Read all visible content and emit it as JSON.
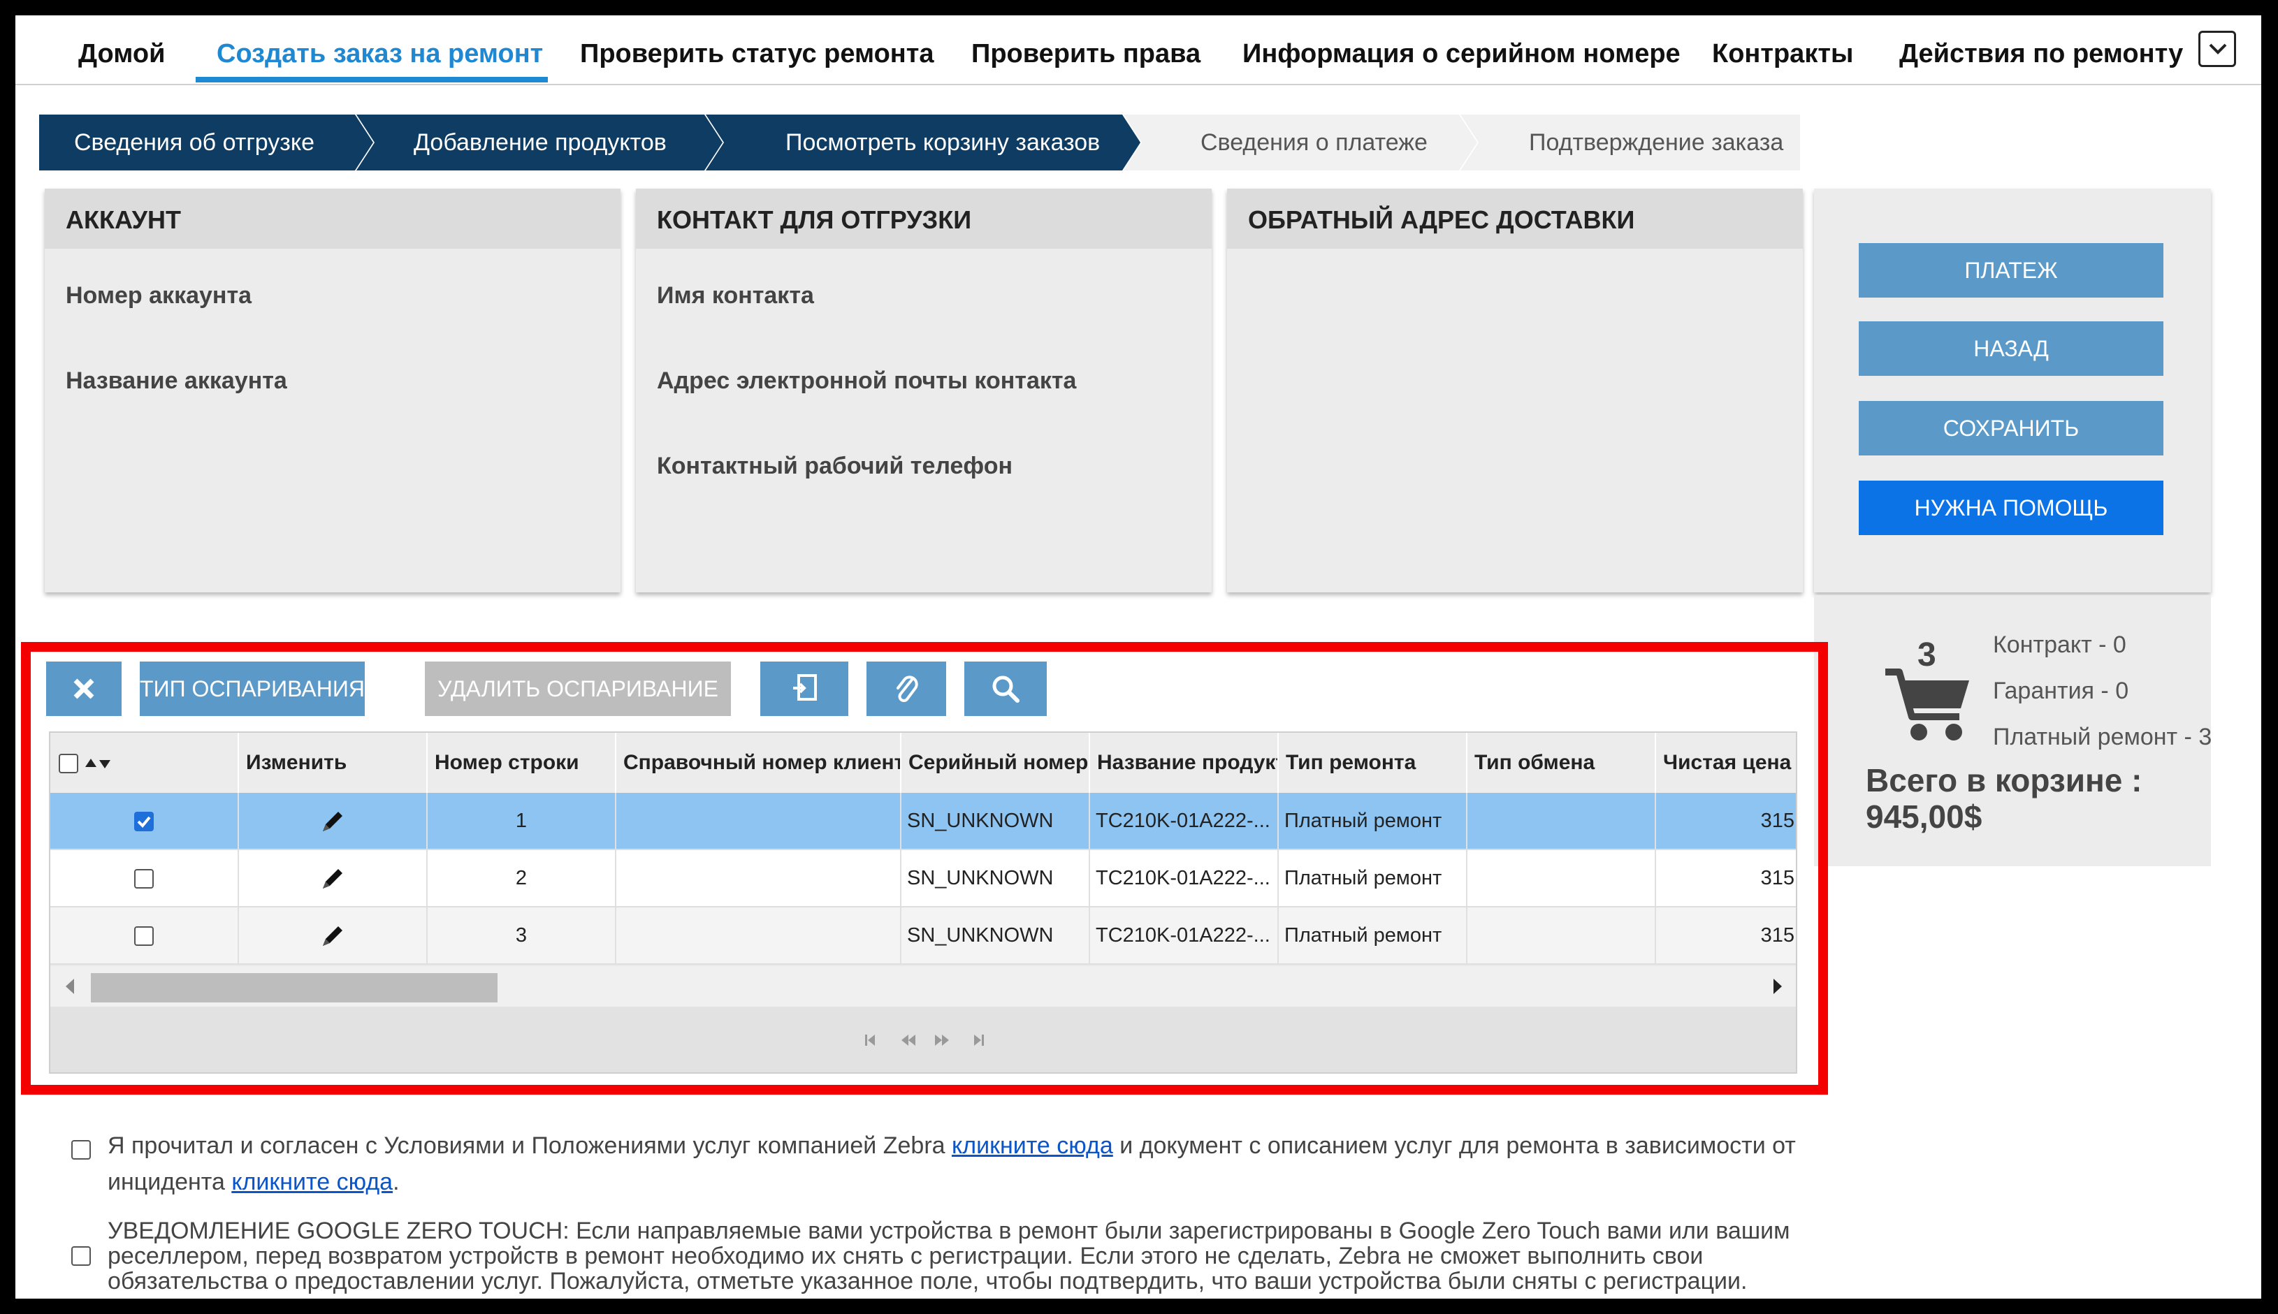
{
  "nav": {
    "items": [
      "Домой",
      "Создать заказ на ремонт",
      "Проверить статус ремонта",
      "Проверить права",
      "Информация о серийном номере",
      "Контракты",
      "Действия по ремонту"
    ],
    "active_index": 1,
    "more_icon": "chevron-down-icon"
  },
  "steps": [
    {
      "label": "Сведения об отгрузке",
      "state": "done"
    },
    {
      "label": "Добавление продуктов",
      "state": "done"
    },
    {
      "label": "Посмотреть корзину заказов",
      "state": "done"
    },
    {
      "label": "Сведения о платеже",
      "state": "pending"
    },
    {
      "label": "Подтверждение заказа",
      "state": "pending"
    }
  ],
  "panels": {
    "account": {
      "title": "АККАУНТ",
      "fields": [
        "Номер аккаунта",
        "Название аккаунта"
      ]
    },
    "shipping_contact": {
      "title": "КОНТАКТ ДЛЯ ОТГРУЗКИ",
      "fields": [
        "Имя контакта",
        "Адрес электронной почты контакта",
        "Контактный рабочий телефон"
      ]
    },
    "return_address": {
      "title": "ОБРАТНЫЙ АДРЕС ДОСТАВКИ",
      "fields": []
    }
  },
  "actions": {
    "payment": "ПЛАТЕЖ",
    "back": "НАЗАД",
    "save": "СОХРАНИТЬ",
    "help": "НУЖНА ПОМОЩЬ"
  },
  "cart": {
    "count": "3",
    "contract": "Контракт - 0",
    "warranty": "Гарантия - 0",
    "paid_repair": "Платный ремонт - 3",
    "total_label": "Всего в корзине :",
    "total_value": "945,00$",
    "icon": "shopping-cart-icon"
  },
  "toolbar": {
    "delete_icon": "close-icon",
    "dispute_type": "ТИП ОСПАРИВАНИЯ",
    "remove_dispute": "УДАЛИТЬ ОСПАРИВАНИЕ",
    "export_icon": "export-icon",
    "attach_icon": "paperclip-icon",
    "search_icon": "search-icon"
  },
  "grid": {
    "columns": [
      "",
      "Изменить",
      "Номер строки",
      "Справочный номер клиента",
      "Серийный номер",
      "Название продукта",
      "Тип ремонта",
      "Тип обмена",
      "Чистая цена"
    ],
    "rows": [
      {
        "checked": true,
        "line": "1",
        "ref": "",
        "serial": "SN_UNKNOWN",
        "product": "TC210K-01A222-...",
        "repair": "Платный ремонт",
        "exchange": "",
        "price": "315"
      },
      {
        "checked": false,
        "line": "2",
        "ref": "",
        "serial": "SN_UNKNOWN",
        "product": "TC210K-01A222-...",
        "repair": "Платный ремонт",
        "exchange": "",
        "price": "315"
      },
      {
        "checked": false,
        "line": "3",
        "ref": "",
        "serial": "SN_UNKNOWN",
        "product": "TC210K-01A222-...",
        "repair": "Платный ремонт",
        "exchange": "",
        "price": "315"
      }
    ]
  },
  "agreement": {
    "terms_before": "Я прочитал и согласен с Условиями и Положениями услуг компанией Zebra ",
    "terms_link1": "кликните сюда",
    "terms_middle": " и документ с описанием услуг для ремонта в зависимости от",
    "terms_line2_before": "инцидента ",
    "terms_link2": "кликните сюда",
    "terms_line2_after": ".",
    "zero_touch": "УВЕДОМЛЕНИЕ GOOGLE ZERO TOUCH: Если направляемые вами устройства в ремонт были зарегистрированы в Google Zero Touch вами или вашим реселлером, перед возвратом устройств в ремонт необходимо их снять с регистрации. Если этого не сделать, Zebra не сможет выполнить свои обязательства о предоставлении услуг. Пожалуйста, отметьте указанное поле, чтобы подтвердить, что ваши устройства были сняты с регистрации."
  }
}
